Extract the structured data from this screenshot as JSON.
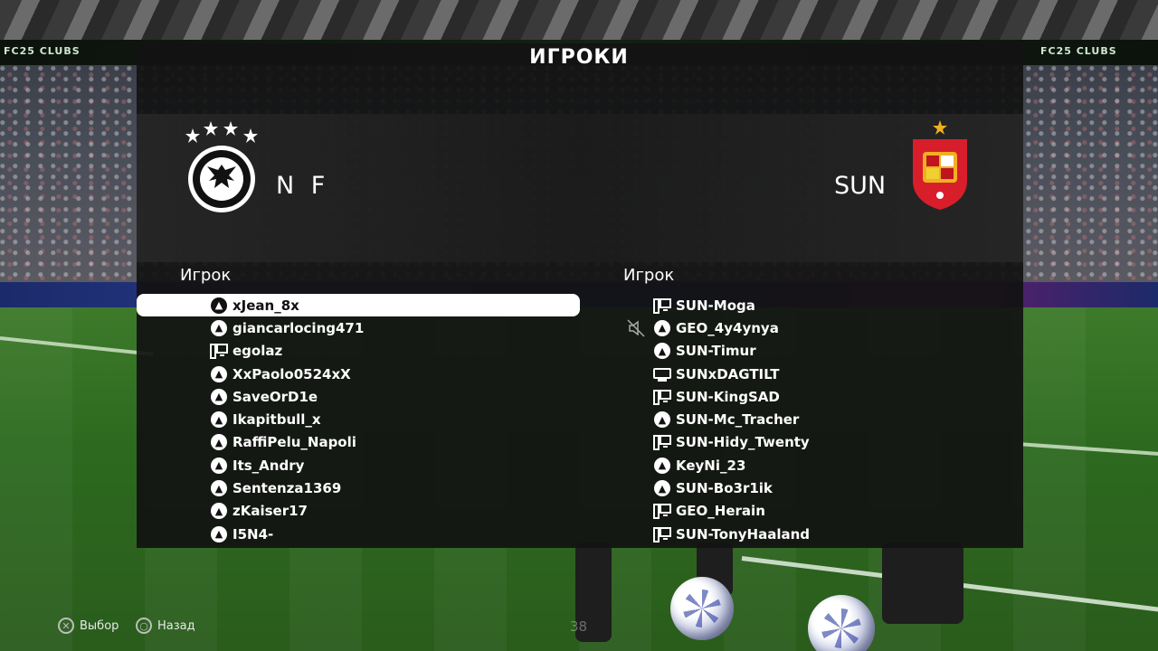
{
  "header": {
    "title": "ИГРОКИ"
  },
  "background": {
    "adboard_left": "FC25 CLUBS",
    "adboard_right": "FC25 CLUBS"
  },
  "team_left": {
    "name": "N F",
    "crest": "germany-dfb-crest"
  },
  "team_right": {
    "name": "SUN",
    "crest": "spain-rfef-crest"
  },
  "columns": {
    "left_header": "Игрок",
    "right_header": "Игрок"
  },
  "left_players": [
    {
      "name": "xJean_8x",
      "platform": "playstation",
      "selected": true
    },
    {
      "name": "giancarlocing471",
      "platform": "playstation"
    },
    {
      "name": "egolaz",
      "platform": "pc"
    },
    {
      "name": "XxPaolo0524xX",
      "platform": "playstation"
    },
    {
      "name": "SaveOrD1e",
      "platform": "playstation"
    },
    {
      "name": "Ikapitbull_x",
      "platform": "playstation"
    },
    {
      "name": "RaffiPelu_Napoli",
      "platform": "playstation"
    },
    {
      "name": "Its_Andry",
      "platform": "playstation"
    },
    {
      "name": "Sentenza1369",
      "platform": "playstation"
    },
    {
      "name": "zKaiser17",
      "platform": "playstation"
    },
    {
      "name": "I5N4-",
      "platform": "playstation"
    }
  ],
  "right_players": [
    {
      "name": "SUN-Moga",
      "platform": "pc"
    },
    {
      "name": "GEO_4y4ynya",
      "platform": "playstation",
      "muted": true
    },
    {
      "name": "SUN-Timur",
      "platform": "playstation"
    },
    {
      "name": "SUNxDAGTILT",
      "platform": "xbox"
    },
    {
      "name": "SUN-KingSAD",
      "platform": "pc"
    },
    {
      "name": "SUN-Mc_Tracher",
      "platform": "playstation"
    },
    {
      "name": "SUN-Hidy_Twenty",
      "platform": "pc"
    },
    {
      "name": "KeyNi_23",
      "platform": "playstation"
    },
    {
      "name": "SUN-Bo3r1ik",
      "platform": "playstation"
    },
    {
      "name": "GEO_Herain",
      "platform": "pc"
    },
    {
      "name": "SUN-TonyHaaland",
      "platform": "pc"
    }
  ],
  "footer": {
    "select_label": "Выбор",
    "back_label": "Назад",
    "page_number": "38"
  }
}
